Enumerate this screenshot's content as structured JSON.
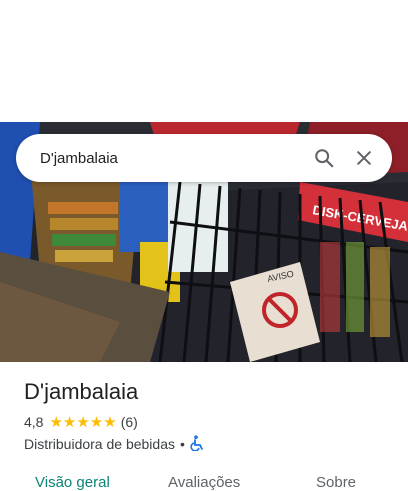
{
  "search": {
    "query": "D'jambalaia"
  },
  "place": {
    "name": "D'jambalaia",
    "rating": "4,8",
    "stars": "★★★★★",
    "review_count": "(6)",
    "category": "Distribuidora de bebidas",
    "separator": "•"
  },
  "photo_signs": {
    "disk": "DISK-CERVEJA",
    "aviso": "AVISO"
  },
  "tabs": [
    "Visão geral",
    "Avaliações",
    "Sobre"
  ],
  "colors": {
    "accent": "#0b8575",
    "star": "#fbbc04",
    "access": "#1a73e8"
  },
  "icons": {
    "search": "search-icon",
    "close": "close-icon",
    "accessible": "wheelchair-icon"
  }
}
